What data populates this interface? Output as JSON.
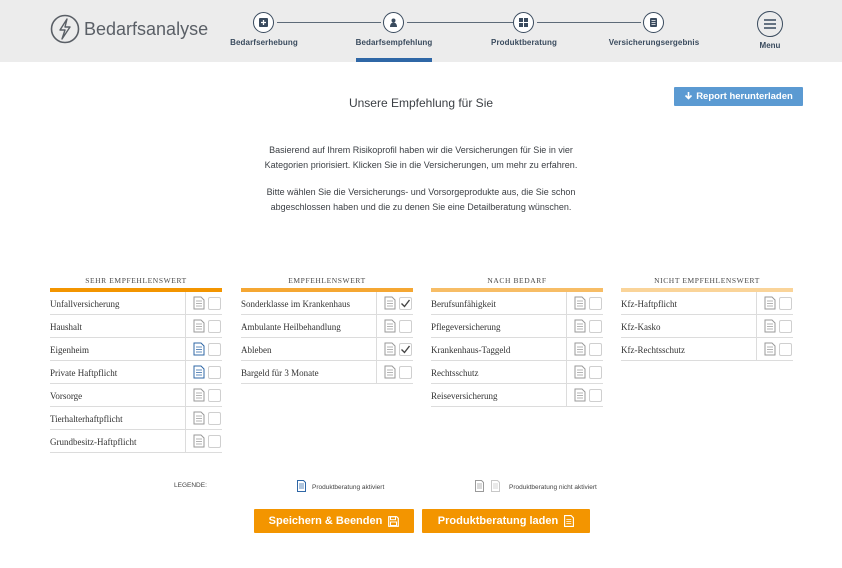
{
  "app": {
    "brand": "Bedarfsanalyse"
  },
  "steps": [
    {
      "label": "Bedarfserhebung",
      "icon": "plus-document-icon",
      "active": false
    },
    {
      "label": "Bedarfsempfehlung",
      "icon": "person-icon",
      "active": true
    },
    {
      "label": "Produktberatung",
      "icon": "grid-icon",
      "active": false
    },
    {
      "label": "Versicherungsergebnis",
      "icon": "document-list-icon",
      "active": false
    }
  ],
  "menu": {
    "label": "Menu"
  },
  "main": {
    "title": "Unsere Empfehlung für Sie",
    "report_button": "Report herunterladen",
    "intro_line1": "Basierend auf Ihrem Risikoprofil haben wir die Versicherungen für Sie in vier",
    "intro_line2": "Kategorien priorisiert. Klicken Sie in die Versicherungen, um mehr zu erfahren.",
    "intro2_line1": "Bitte wählen Sie die Versicherungs- und Vorsorgeprodukte aus, die Sie schon",
    "intro2_line2": "abgeschlossen haben und die zu denen Sie eine Detailberatung wünschen."
  },
  "colors": {
    "accent": "#f39500",
    "active_step": "#2f67a6",
    "report": "#5b9ad2"
  },
  "categories": [
    {
      "title": "SEHR EMPFEHLENSWERT",
      "bar_color": "#f39500",
      "items": [
        {
          "name": "Unfallversicherung",
          "doc_active": false,
          "checked": false
        },
        {
          "name": "Haushalt",
          "doc_active": false,
          "checked": false
        },
        {
          "name": "Eigenheim",
          "doc_active": true,
          "checked": false
        },
        {
          "name": "Private Haftpflicht",
          "doc_active": true,
          "checked": false
        },
        {
          "name": "Vorsorge",
          "doc_active": false,
          "checked": false
        },
        {
          "name": "Tierhalterhaftpflicht",
          "doc_active": false,
          "checked": false
        },
        {
          "name": "Grundbesitz-Haftpflicht",
          "doc_active": false,
          "checked": false
        }
      ]
    },
    {
      "title": "EMPFEHLENSWERT",
      "bar_color": "#f5a733",
      "items": [
        {
          "name": "Sonderklasse im Krankenhaus",
          "doc_active": false,
          "checked": true
        },
        {
          "name": "Ambulante Heilbehandlung",
          "doc_active": false,
          "checked": false
        },
        {
          "name": "Ableben",
          "doc_active": false,
          "checked": true
        },
        {
          "name": "Bargeld für 3 Monate",
          "doc_active": false,
          "checked": false
        }
      ]
    },
    {
      "title": "NACH BEDARF",
      "bar_color": "#f7bd66",
      "items": [
        {
          "name": "Berufsunfähigkeit",
          "doc_active": false,
          "checked": false
        },
        {
          "name": "Pflegeversicherung",
          "doc_active": false,
          "checked": false
        },
        {
          "name": "Krankenhaus-Taggeld",
          "doc_active": false,
          "checked": false
        },
        {
          "name": "Rechtsschutz",
          "doc_active": false,
          "checked": false
        },
        {
          "name": "Reiseversicherung",
          "doc_active": false,
          "checked": false
        }
      ]
    },
    {
      "title": "NICHT EMPFEHLENSWERT",
      "bar_color": "#fad499",
      "items": [
        {
          "name": "Kfz-Haftpflicht",
          "doc_active": false,
          "checked": false
        },
        {
          "name": "Kfz-Kasko",
          "doc_active": false,
          "checked": false
        },
        {
          "name": "Kfz-Rechtsschutz",
          "doc_active": false,
          "checked": false
        }
      ]
    }
  ],
  "legend": {
    "label": "LEGENDE:",
    "active": "Produktberatung aktiviert",
    "inactive": "Produktberatung nicht aktiviert"
  },
  "buttons": {
    "save": "Speichern & Beenden",
    "load": "Produktberatung laden"
  }
}
